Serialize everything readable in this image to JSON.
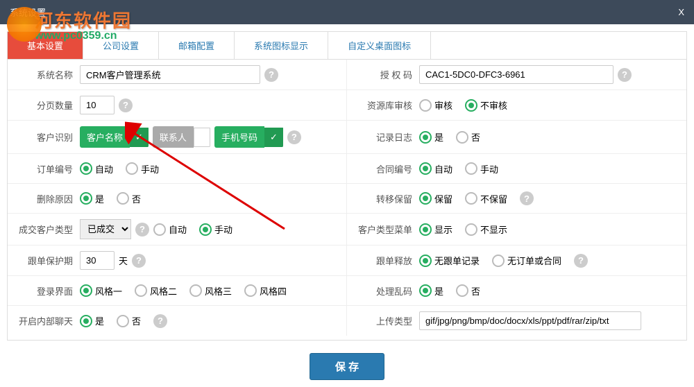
{
  "window": {
    "title": "系统设置",
    "close": "X"
  },
  "watermark": {
    "text": "河东软件园",
    "url": "www.pc0359.cn"
  },
  "tabs": [
    "基本设置",
    "公司设置",
    "邮箱配置",
    "系统图标显示",
    "自定义桌面图标"
  ],
  "left": {
    "system_name": {
      "label": "系统名称",
      "value": "CRM客户管理系统"
    },
    "page_count": {
      "label": "分页数量",
      "value": "10"
    },
    "cust_id": {
      "label": "客户识别",
      "tag1": "客户名称",
      "tag2": "联系人",
      "tag3": "手机号码"
    },
    "order_no": {
      "label": "订单编号",
      "opt1": "自动",
      "opt2": "手动"
    },
    "del_reason": {
      "label": "删除原因",
      "opt1": "是",
      "opt2": "否"
    },
    "deal_type": {
      "label": "成交客户类型",
      "select": "已成交",
      "opt1": "自动",
      "opt2": "手动"
    },
    "follow_protect": {
      "label": "跟单保护期",
      "value": "30",
      "unit": "天"
    },
    "login_style": {
      "label": "登录界面",
      "opt1": "风格一",
      "opt2": "风格二",
      "opt3": "风格三",
      "opt4": "风格四"
    },
    "internal_chat": {
      "label": "开启内部聊天",
      "opt1": "是",
      "opt2": "否"
    }
  },
  "right": {
    "auth_code": {
      "label": "授 权 码",
      "value": "CAC1-5DC0-DFC3-6961"
    },
    "res_audit": {
      "label": "资源库审核",
      "opt1": "审核",
      "opt2": "不审核"
    },
    "log": {
      "label": "记录日志",
      "opt1": "是",
      "opt2": "否"
    },
    "contract_no": {
      "label": "合同编号",
      "opt1": "自动",
      "opt2": "手动"
    },
    "transfer_keep": {
      "label": "转移保留",
      "opt1": "保留",
      "opt2": "不保留"
    },
    "cust_menu": {
      "label": "客户类型菜单",
      "opt1": "显示",
      "opt2": "不显示"
    },
    "follow_release": {
      "label": "跟单释放",
      "opt1": "无跟单记录",
      "opt2": "无订单或合同"
    },
    "garbled": {
      "label": "处理乱码",
      "opt1": "是",
      "opt2": "否"
    },
    "upload_type": {
      "label": "上传类型",
      "value": "gif/jpg/png/bmp/doc/docx/xls/ppt/pdf/rar/zip/txt"
    }
  },
  "save": "保 存",
  "help_icon": "?"
}
